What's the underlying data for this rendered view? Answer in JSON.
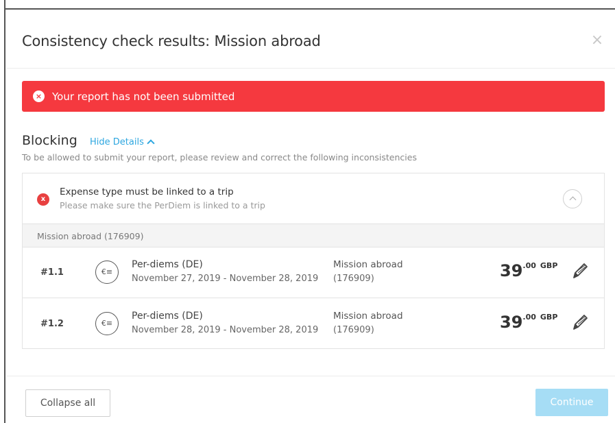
{
  "modal": {
    "title": "Consistency check results: Mission abroad",
    "close_icon": "×"
  },
  "alert": {
    "icon": "×",
    "text": "Your report has not been submitted",
    "color": "#f5393f"
  },
  "section": {
    "title": "Blocking",
    "toggle_label": "Hide Details",
    "description": "To be allowed to submit your report, please review and correct the following inconsistencies"
  },
  "issue": {
    "icon": "x",
    "title": "Expense type must be linked to a trip",
    "subtitle": "Please make sure the PerDiem is linked to a trip"
  },
  "group": {
    "label": "Mission abroad (176909)"
  },
  "expenses": [
    {
      "index": "#1.1",
      "icon_label": "€≡",
      "type": "Per-diems (DE)",
      "dates": "November 27, 2019 - November 28, 2019",
      "trip": "Mission abroad",
      "trip_id": "(176909)",
      "amount_int": "39",
      "amount_dec": ".00",
      "currency": "GBP"
    },
    {
      "index": "#1.2",
      "icon_label": "€≡",
      "type": "Per-diems (DE)",
      "dates": "November 28, 2019 - November 28, 2019",
      "trip": "Mission abroad",
      "trip_id": "(176909)",
      "amount_int": "39",
      "amount_dec": ".00",
      "currency": "GBP"
    }
  ],
  "footer": {
    "collapse_label": "Collapse all",
    "continue_label": "Continue"
  }
}
